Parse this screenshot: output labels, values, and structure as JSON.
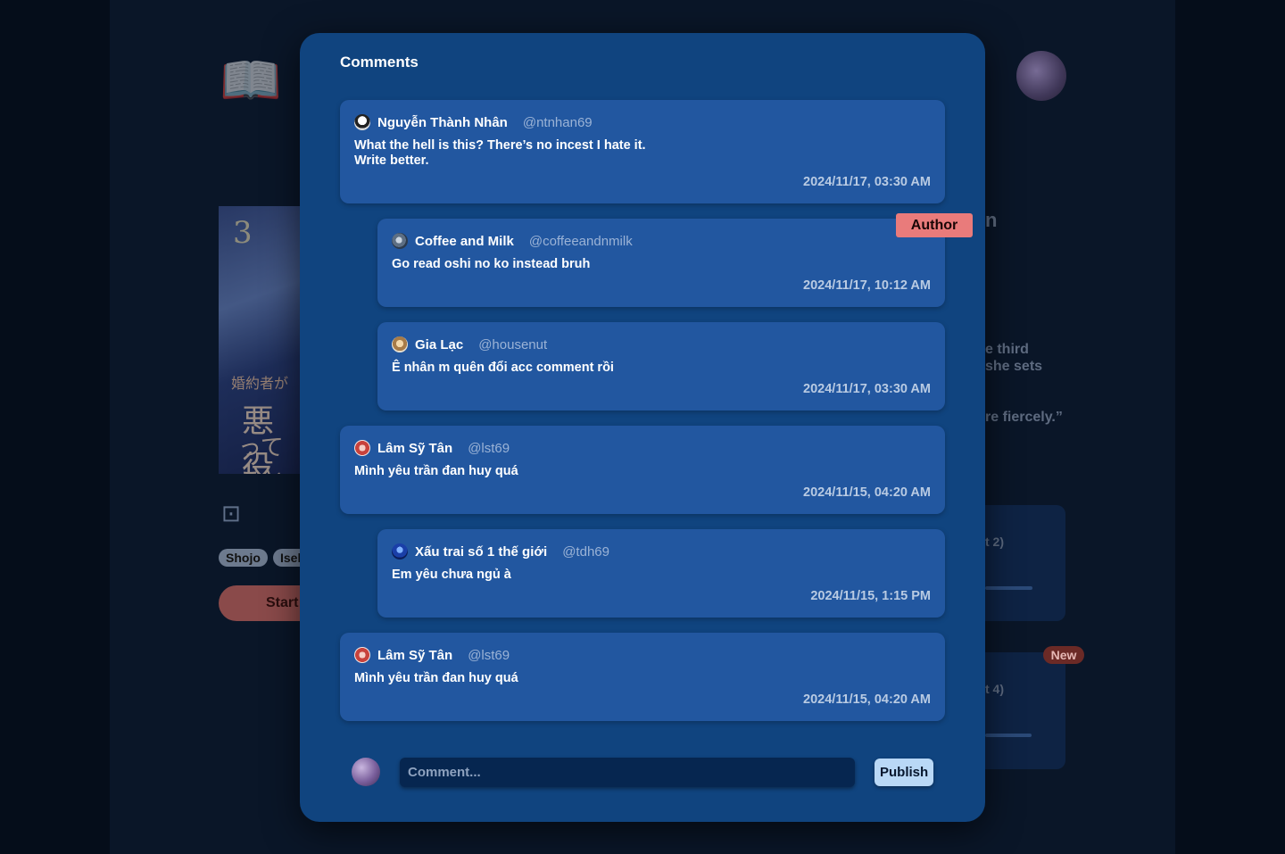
{
  "background": {
    "logo_icon": "open-book-icon",
    "tags": [
      "Shojo",
      "Isel"
    ],
    "start_label": "Start",
    "cover_text": {
      "volume": "3",
      "line1": "婚約者が",
      "line2": "悪役",
      "line3": "ってこと"
    },
    "snippets": [
      "n",
      "e third",
      "she sets",
      "re fiercely.”",
      "t 2)",
      "t 4)"
    ],
    "new_badge": "New"
  },
  "modal": {
    "title": "Comments",
    "author_badge": "Author",
    "comments": [
      {
        "name": "Nguyễn Thành Nhân",
        "handle": "@ntnhan69",
        "body_line1": "What the hell is this? There’s no incest I hate it.",
        "body_line2": "Write better.",
        "time": "2024/11/17, 03:30 AM",
        "reply": false
      },
      {
        "name": "Coffee and Milk",
        "handle": "@coffeeandnmilk",
        "body_line1": "Go read oshi no ko instead bruh",
        "body_line2": "",
        "time": "2024/11/17, 10:12 AM",
        "reply": true
      },
      {
        "name": "Gia Lạc",
        "handle": "@housenut",
        "body_line1": "Ê nhân m quên đổi acc comment rồi",
        "body_line2": "",
        "time": "2024/11/17, 03:30 AM",
        "reply": true
      },
      {
        "name": "Lâm Sỹ Tân",
        "handle": "@lst69",
        "body_line1": "Mình yêu trần đan huy quá",
        "body_line2": "",
        "time": "2024/11/15, 04:20 AM",
        "reply": false
      },
      {
        "name": "Xấu trai số 1 thế giới",
        "handle": "@tdh69",
        "body_line1": "Em yêu chưa ngủ à",
        "body_line2": "",
        "time": "2024/11/15, 1:15 PM",
        "reply": true
      },
      {
        "name": "Lâm Sỹ Tân",
        "handle": "@lst69",
        "body_line1": "Mình yêu trần đan huy quá",
        "body_line2": "",
        "time": "2024/11/15, 04:20 AM",
        "reply": false
      }
    ],
    "input": {
      "placeholder": "Comment...",
      "value": ""
    },
    "publish_label": "Publish"
  }
}
